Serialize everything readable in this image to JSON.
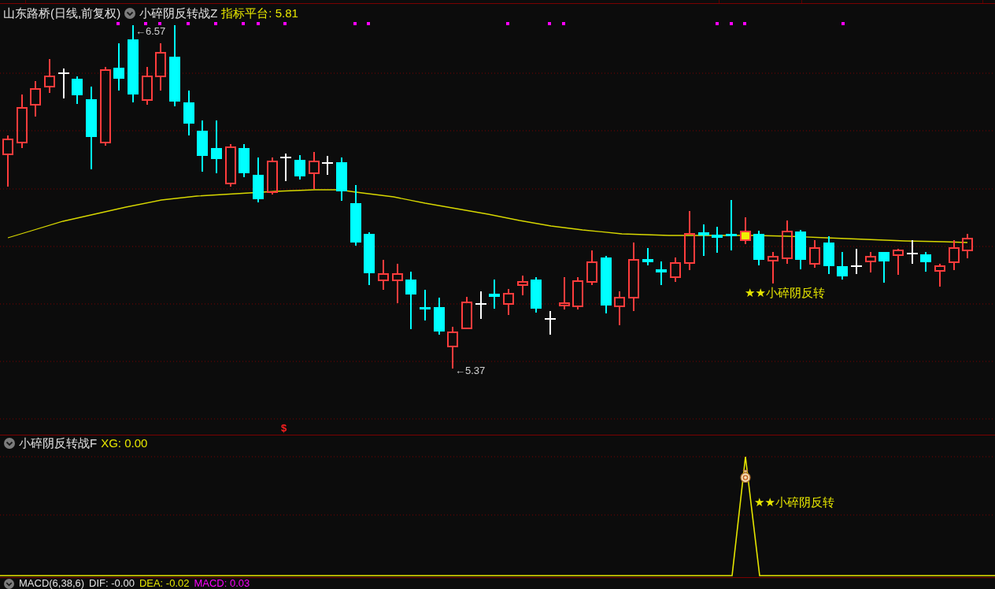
{
  "main_panel": {
    "stock_title": "山东路桥(日线,前复权)",
    "indicator_name": "小碎阴反转战Z",
    "indicator_value": "指标平台: 5.81",
    "high_label": "←6.57",
    "low_label": "←5.37",
    "signal_label": "★★小碎阴反转",
    "buy_marker": "$"
  },
  "signal_panel": {
    "indicator_name": "小碎阴反转战F",
    "indicator_value": "XG: 0.00",
    "signal_label": "★★小碎阴反转"
  },
  "macd_panel": {
    "indicator_name": "MACD(6,38,6)",
    "values": [
      {
        "text": "DIF: -0.00",
        "color": "#e6e6e6"
      },
      {
        "text": "DEA: -0.02",
        "color": "#e6e600"
      },
      {
        "text": "MACD: 0.03",
        "color": "#ff00ff"
      }
    ]
  }
}
